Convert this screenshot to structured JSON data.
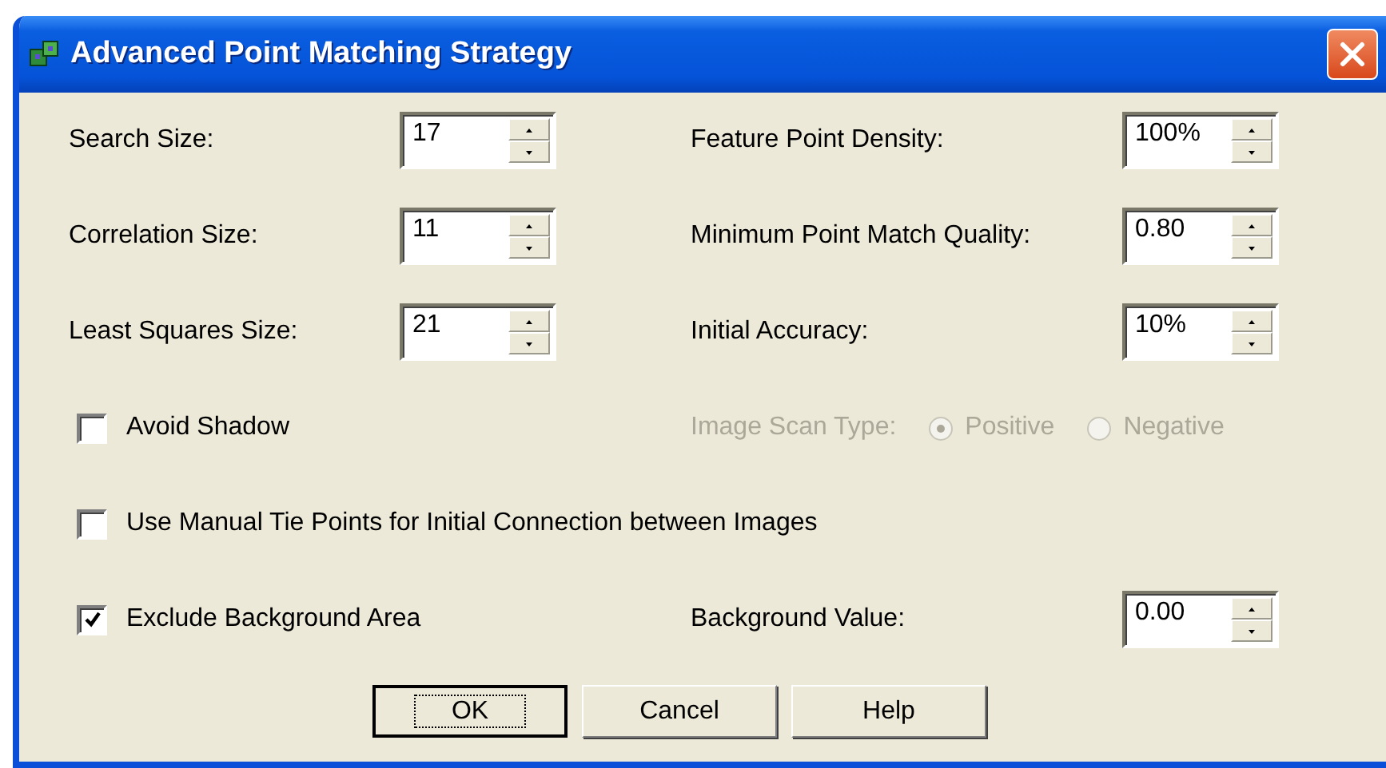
{
  "window": {
    "title": "Advanced Point Matching Strategy"
  },
  "left_fields": [
    {
      "label": "Search Size:",
      "value": "17"
    },
    {
      "label": "Correlation Size:",
      "value": "11"
    },
    {
      "label": "Least Squares Size:",
      "value": "21"
    }
  ],
  "right_fields": [
    {
      "label": "Feature Point Density:",
      "value": "100%"
    },
    {
      "label": "Minimum Point Match Quality:",
      "value": "0.80"
    },
    {
      "label": "Initial Accuracy:",
      "value": "10%"
    }
  ],
  "avoid_shadow": {
    "label": "Avoid Shadow",
    "checked": false
  },
  "image_scan_type": {
    "label": "Image Scan Type:",
    "disabled": true,
    "options": [
      {
        "label": "Positive",
        "selected": true
      },
      {
        "label": "Negative",
        "selected": false
      }
    ]
  },
  "manual_tie_points": {
    "label": "Use Manual Tie Points for Initial Connection between Images",
    "checked": false
  },
  "exclude_background": {
    "label": "Exclude Background Area",
    "checked": true
  },
  "background_value": {
    "label": "Background Value:",
    "value": "0.00"
  },
  "buttons": [
    {
      "label": "OK",
      "default": true
    },
    {
      "label": "Cancel",
      "default": false
    },
    {
      "label": "Help",
      "default": false
    }
  ]
}
